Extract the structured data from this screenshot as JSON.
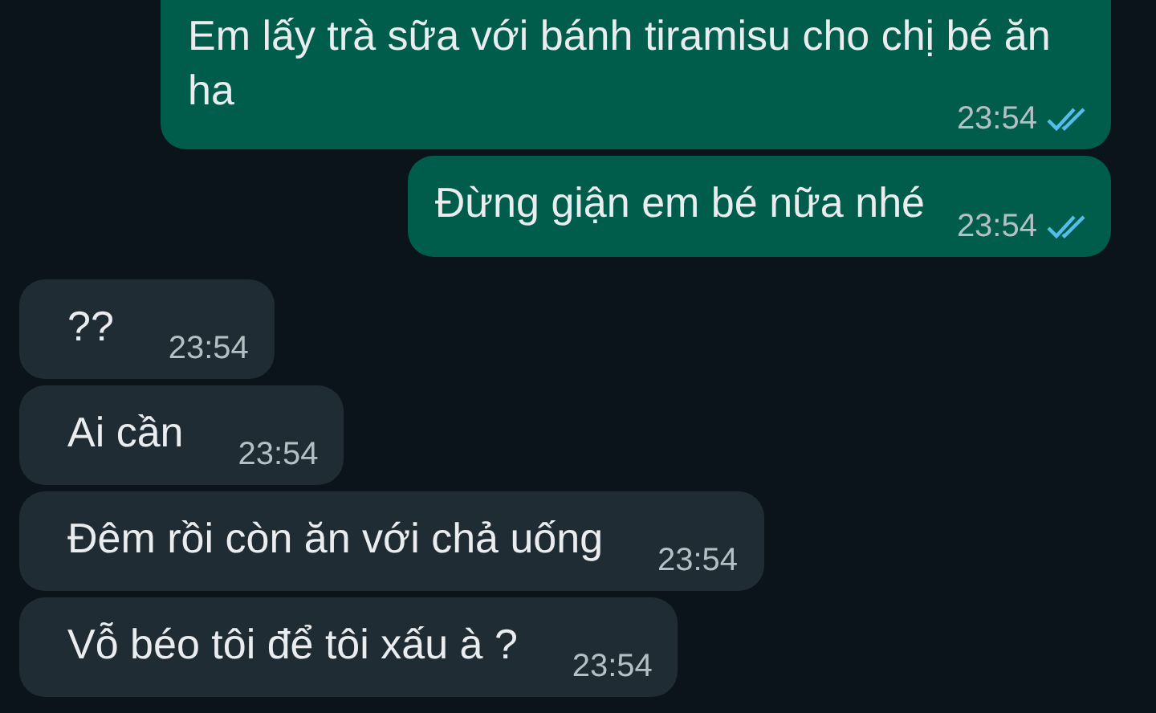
{
  "messages": [
    {
      "kind": "outgoing",
      "text": "Em lấy trà sữa với bánh tiramisu cho chị bé ăn ha",
      "time": "23:54",
      "read": true
    },
    {
      "kind": "outgoing",
      "text": "Đừng giận em bé nữa nhé",
      "time": "23:54",
      "read": true
    },
    {
      "kind": "incoming",
      "text": "??",
      "time": "23:54"
    },
    {
      "kind": "incoming",
      "text": "Ai cần",
      "time": "23:54"
    },
    {
      "kind": "incoming",
      "text": "Đêm rồi còn ăn với chả uống",
      "time": "23:54"
    },
    {
      "kind": "incoming",
      "text": "Vỗ béo tôi để tôi xấu à ?",
      "time": "23:54"
    }
  ]
}
